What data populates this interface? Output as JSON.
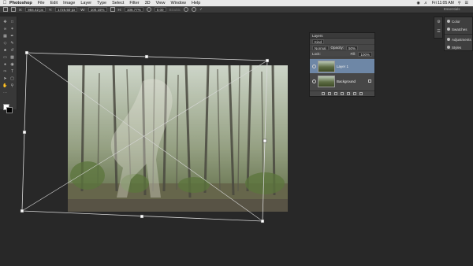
{
  "menubar": {
    "apple": "",
    "items": [
      "Photoshop",
      "File",
      "Edit",
      "Image",
      "Layer",
      "Type",
      "Select",
      "Filter",
      "3D",
      "View",
      "Window",
      "Help"
    ],
    "clock": "Fri 11:05 AM"
  },
  "options": {
    "x": "984.42 px",
    "y": "1725.50 px",
    "w": "100.15%",
    "h": "106.77%",
    "angle": "0.00",
    "interpolation": "Bicubic",
    "workspace": "Essentials"
  },
  "layers_panel": {
    "tab": "Layers",
    "filter_label": "Kind",
    "blend_mode": "Normal",
    "opacity_label": "Opacity:",
    "opacity_value": "50%",
    "lock_label": "Lock:",
    "fill_label": "Fill:",
    "fill_value": "100%",
    "layers": [
      {
        "name": "Layer 1",
        "selected": true
      },
      {
        "name": "Background",
        "selected": false
      }
    ]
  },
  "right_panel": {
    "items": [
      "Color",
      "Swatches",
      "Adjustments",
      "Styles"
    ]
  },
  "colors": {
    "foreground": "#ffffff",
    "background": "#000000",
    "selection": "#6e87a6"
  }
}
